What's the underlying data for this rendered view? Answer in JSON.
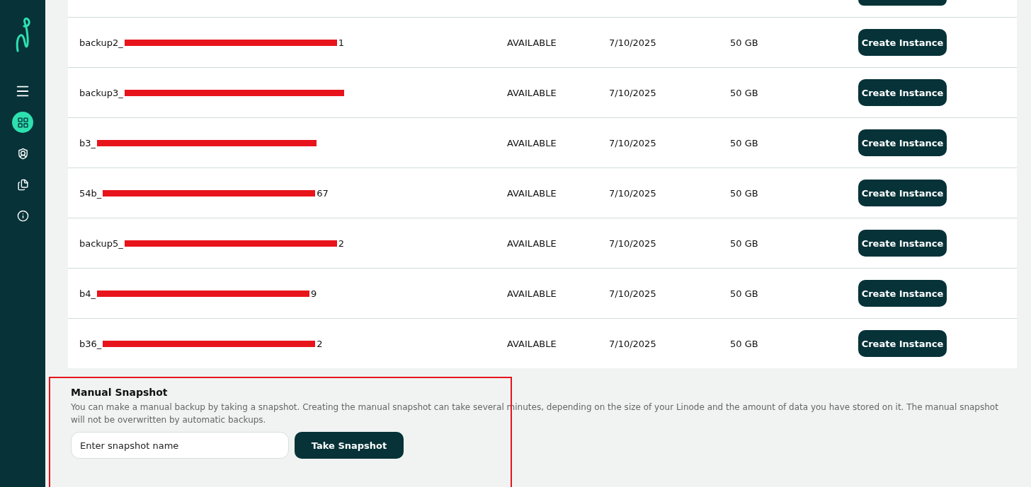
{
  "sidebar": {
    "items": [
      {
        "selected": false
      },
      {
        "selected": true
      },
      {
        "selected": false
      },
      {
        "selected": false
      },
      {
        "selected": false
      }
    ]
  },
  "backups": {
    "rows": [
      {
        "name_prefix": "backup2_",
        "name_suffix": "1",
        "status": "AVAILABLE",
        "date": "7/10/2025",
        "size": "50 GB",
        "action": "Create Instance"
      },
      {
        "name_prefix": "backup3_",
        "status": "AVAILABLE",
        "date": "7/10/2025",
        "size": "50 GB",
        "action": "Create Instance"
      },
      {
        "name_prefix": "b3_",
        "status": "AVAILABLE",
        "date": "7/10/2025",
        "size": "50 GB",
        "action": "Create Instance"
      },
      {
        "name_prefix": "54b_",
        "name_suffix": "67",
        "status": "AVAILABLE",
        "date": "7/10/2025",
        "size": "50 GB",
        "action": "Create Instance"
      },
      {
        "name_prefix": "backup5_",
        "name_suffix": "2",
        "status": "AVAILABLE",
        "date": "7/10/2025",
        "size": "50 GB",
        "action": "Create Instance"
      },
      {
        "name_prefix": "b4_",
        "name_suffix": "9",
        "status": "AVAILABLE",
        "date": "7/10/2025",
        "size": "50 GB",
        "action": "Create Instance"
      },
      {
        "name_prefix": "b36_",
        "name_suffix": "2",
        "status": "AVAILABLE",
        "date": "7/10/2025",
        "size": "50 GB",
        "action": "Create Instance"
      }
    ]
  },
  "manual_snapshot": {
    "title": "Manual Snapshot",
    "description": "You can make a manual backup by taking a snapshot. Creating the manual snapshot can take several minutes, depending on the size of your Linode and the amount of data you have stored on it. The manual snapshot will not be overwritten by automatic backups.",
    "placeholder": "Enter snapshot name",
    "button": "Take Snapshot"
  }
}
